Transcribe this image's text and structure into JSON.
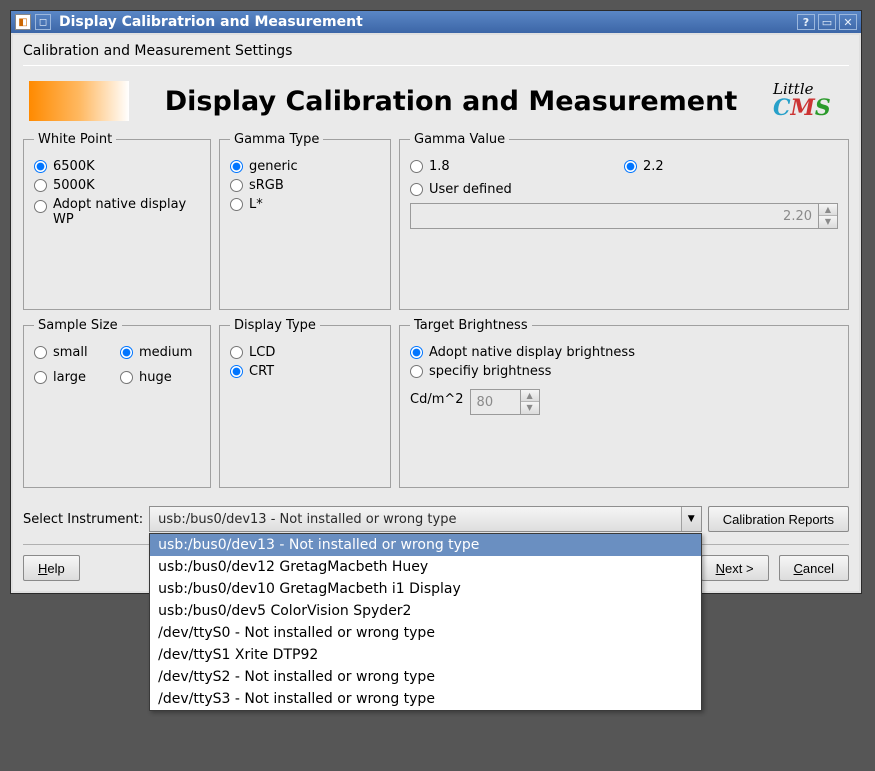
{
  "window": {
    "title": "Display Calibratrion and Measurement"
  },
  "subtitle": "Calibration and Measurement Settings",
  "banner": {
    "heading": "Display Calibration and Measurement",
    "logo_line1": "Little",
    "logo_c": "C",
    "logo_m": "M",
    "logo_s": "S"
  },
  "groups": {
    "whitepoint": {
      "legend": "White Point",
      "opt_6500k": "6500K",
      "opt_5000k": "5000K",
      "opt_native": "Adopt native display WP",
      "selected": "6500K"
    },
    "gammatype": {
      "legend": "Gamma Type",
      "opt_generic": "generic",
      "opt_srgb": "sRGB",
      "opt_lstar": "L*",
      "selected": "generic"
    },
    "gammavalue": {
      "legend": "Gamma Value",
      "opt_18": "1.8",
      "opt_22": "2.2",
      "opt_user": "User defined",
      "selected": "2.2",
      "spin_value": "2.20"
    },
    "samplesize": {
      "legend": "Sample Size",
      "opt_small": "small",
      "opt_medium": "medium",
      "opt_large": "large",
      "opt_huge": "huge",
      "selected": "medium"
    },
    "displaytype": {
      "legend": "Display Type",
      "opt_lcd": "LCD",
      "opt_crt": "CRT",
      "selected": "CRT"
    },
    "targetbrightness": {
      "legend": "Target Brightness",
      "opt_native": "Adopt native display brightness",
      "opt_specify": "specifiy brightness",
      "selected": "native",
      "unit_label": "Cd/m^2",
      "spin_value": "80"
    }
  },
  "instrument": {
    "label": "Select Instrument:",
    "selected": "usb:/bus0/dev13  - Not installed or wrong type",
    "options": [
      "usb:/bus0/dev13  - Not installed or wrong type",
      "usb:/bus0/dev12  GretagMacbeth Huey",
      "usb:/bus0/dev10  GretagMacbeth i1 Display",
      "usb:/bus0/dev5  ColorVision Spyder2",
      "/dev/ttyS0 - Not installed or wrong type",
      "/dev/ttyS1 Xrite DTP92",
      "/dev/ttyS2 - Not installed or wrong type",
      "/dev/ttyS3 - Not installed or wrong type"
    ]
  },
  "buttons": {
    "calibration_reports": "Calibration Reports",
    "help_h": "H",
    "help_rest": "elp",
    "next_n": "N",
    "next_rest": "ext >",
    "cancel_c": "C",
    "cancel_rest": "ancel"
  }
}
